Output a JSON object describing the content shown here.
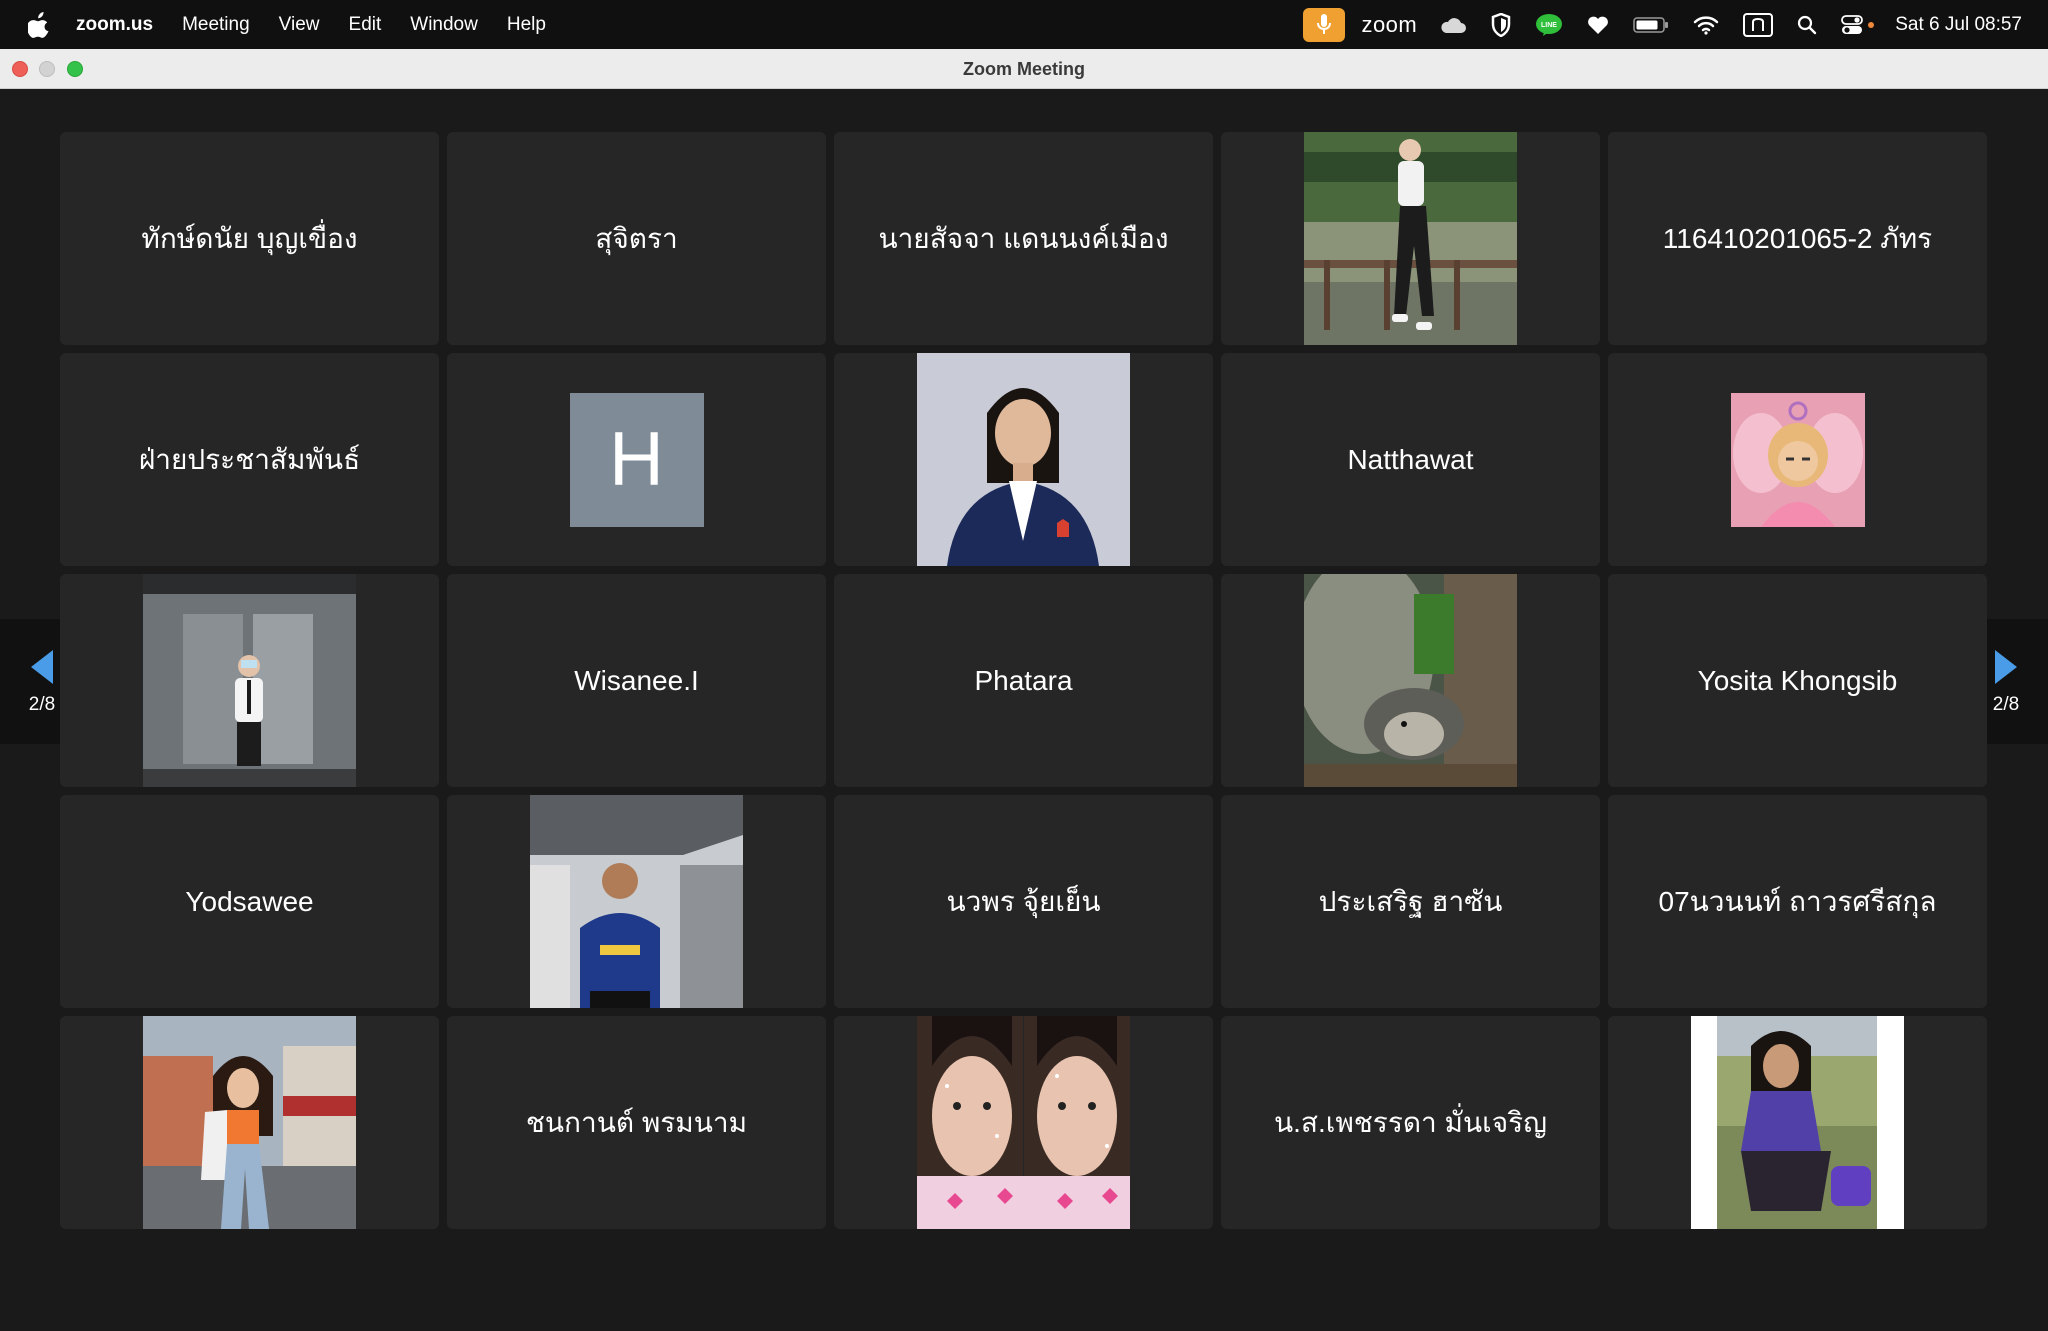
{
  "menubar": {
    "app_name": "zoom.us",
    "items": [
      "Meeting",
      "View",
      "Edit",
      "Window",
      "Help"
    ],
    "zoom_label": "zoom",
    "clock": "Sat 6 Jul  08:57"
  },
  "window": {
    "title": "Zoom Meeting"
  },
  "pagination": {
    "prev_label": "2/8",
    "next_label": "2/8"
  },
  "participants": [
    {
      "name": "ทักษ์ดนัย บุญเขื่อง",
      "display": "name"
    },
    {
      "name": "สุจิตรา",
      "display": "name"
    },
    {
      "name": "นายสัจจา แดนนงค์เมือง",
      "display": "name"
    },
    {
      "name": "",
      "display": "photo",
      "photo": "man-by-lake"
    },
    {
      "name": "116410201065-2 ภัทร",
      "display": "name"
    },
    {
      "name": "ฝ่ายประชาสัมพันธ์",
      "display": "name"
    },
    {
      "name": "",
      "display": "letter",
      "letter": "H"
    },
    {
      "name": "",
      "display": "photo",
      "photo": "woman-navy-blazer"
    },
    {
      "name": "Natthawat",
      "display": "name"
    },
    {
      "name": "",
      "display": "small-photo",
      "photo": "cartoon-fairy"
    },
    {
      "name": "",
      "display": "photo",
      "photo": "man-in-elevator"
    },
    {
      "name": "Wisanee.I",
      "display": "name"
    },
    {
      "name": "Phatara",
      "display": "name"
    },
    {
      "name": "",
      "display": "photo",
      "photo": "hedgehog-in-tree"
    },
    {
      "name": "Yosita Khongsib",
      "display": "name"
    },
    {
      "name": "Yodsawee",
      "display": "name"
    },
    {
      "name": "",
      "display": "photo",
      "photo": "man-blue-polo"
    },
    {
      "name": "นวพร จุ้ยเย็น",
      "display": "name"
    },
    {
      "name": "ประเสริฐ ฮาซัน",
      "display": "name"
    },
    {
      "name": "07นวนนท์ ถาวรศรีสกุล",
      "display": "name"
    },
    {
      "name": "",
      "display": "photo",
      "photo": "woman-street"
    },
    {
      "name": "ชนกานต์ พรมนาม",
      "display": "name"
    },
    {
      "name": "",
      "display": "photo",
      "photo": "selfie-sparkles"
    },
    {
      "name": "น.ส.เพชรรดา มั่นเจริญ",
      "display": "name"
    },
    {
      "name": "",
      "display": "photo",
      "photo": "girl-in-grass"
    }
  ],
  "colors": {
    "background": "#1a1a1a",
    "tile": "#262626",
    "arrow": "#4a9be8",
    "mic_pill": "#f0a030",
    "avatar_letter_bg": "#7f8c98"
  }
}
